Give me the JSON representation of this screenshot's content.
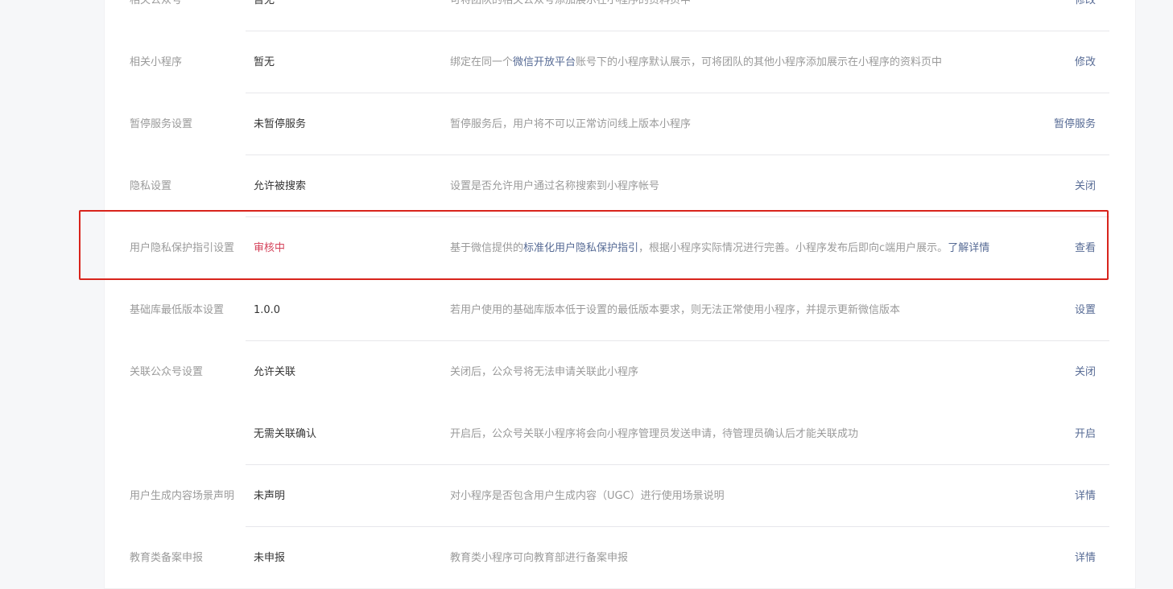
{
  "rows": [
    {
      "label": "相关公众号",
      "value": "暂无",
      "desc": "可将团队的相关公众号添加展示在小程序的资料页中",
      "action": "修改"
    },
    {
      "label": "相关小程序",
      "value": "暂无",
      "desc_pre": "绑定在同一个",
      "desc_link": "微信开放平台",
      "desc_post": "账号下的小程序默认展示，可将团队的其他小程序添加展示在小程序的资料页中",
      "action": "修改"
    },
    {
      "label": "暂停服务设置",
      "value": "未暂停服务",
      "desc": "暂停服务后，用户将不可以正常访问线上版本小程序",
      "action": "暂停服务"
    },
    {
      "label": "隐私设置",
      "value": "允许被搜索",
      "desc": "设置是否允许用户通过名称搜索到小程序帐号",
      "action": "关闭"
    },
    {
      "label": "用户隐私保护指引设置",
      "value": "审核中",
      "desc_pre": "基于微信提供的",
      "desc_link": "标准化用户隐私保护指引",
      "desc_mid": "，根据小程序实际情况进行完善。小程序发布后即向c端用户展示。",
      "desc_link2": "了解详情",
      "action": "查看"
    },
    {
      "label": "基础库最低版本设置",
      "value": "1.0.0",
      "desc": "若用户使用的基础库版本低于设置的最低版本要求，则无法正常使用小程序，并提示更新微信版本",
      "action": "设置"
    },
    {
      "label": "关联公众号设置",
      "value": "允许关联",
      "desc": "关闭后，公众号将无法申请关联此小程序",
      "action": "关闭"
    },
    {
      "label": "",
      "value": "无需关联确认",
      "desc": "开启后，公众号关联小程序将会向小程序管理员发送申请，待管理员确认后才能关联成功",
      "action": "开启"
    },
    {
      "label": "用户生成内容场景声明",
      "value": "未声明",
      "desc": "对小程序是否包含用户生成内容（UGC）进行使用场景说明",
      "action": "详情"
    },
    {
      "label": "教育类备案申报",
      "value": "未申报",
      "desc": "教育类小程序可向教育部进行备案申报",
      "action": "详情"
    }
  ],
  "colors": {
    "label": "#9a9a9a",
    "value": "#353535",
    "pending": "#d5435b",
    "link": "#576b95",
    "highlight": "#d8241c"
  }
}
